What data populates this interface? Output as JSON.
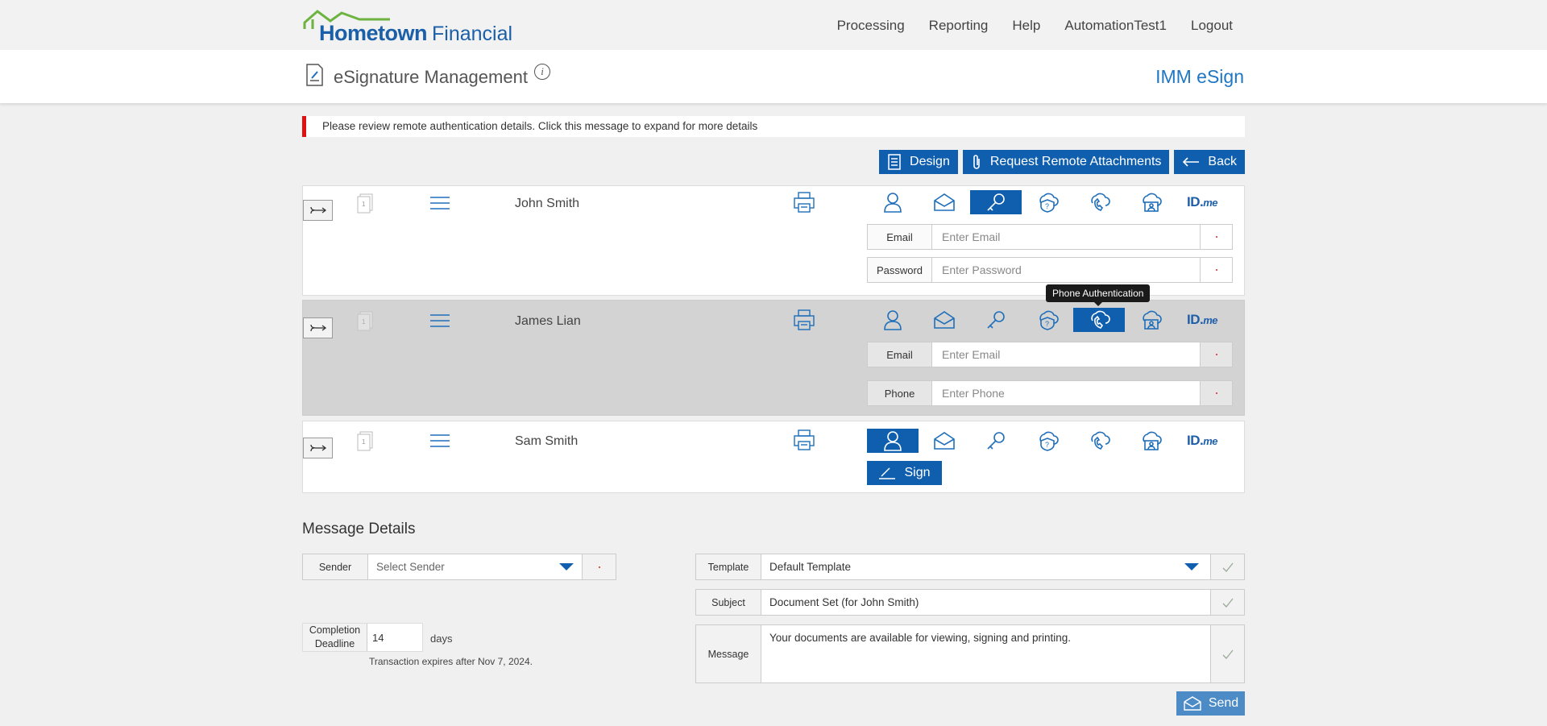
{
  "brand": {
    "name_bold": "Hometown",
    "name_light": "Financial"
  },
  "topnav": [
    "Processing",
    "Reporting",
    "Help",
    "AutomationTest1",
    "Logout"
  ],
  "subheader": {
    "title": "eSignature Management",
    "info_icon": "i",
    "right_title": "IMM eSign"
  },
  "alert": {
    "text": "Please review remote authentication details. Click this message to expand for more details",
    "color": "#e01010"
  },
  "actions": {
    "design": "Design",
    "attachments": "Request Remote Attachments",
    "back": "Back"
  },
  "signers": [
    {
      "name": "John Smith",
      "selected_auth": "key-icon",
      "page_badge": "1",
      "fields": [
        {
          "label": "Email",
          "placeholder": "Enter Email"
        },
        {
          "label": "Password",
          "placeholder": "Enter Password"
        }
      ]
    },
    {
      "name": "James Lian",
      "selected_auth": "phone-icon",
      "page_badge": "1",
      "tooltip": "Phone Authentication",
      "fields": [
        {
          "label": "Email",
          "placeholder": "Enter Email"
        },
        {
          "label": "Phone",
          "placeholder": "Enter Phone"
        }
      ]
    },
    {
      "name": "Sam Smith",
      "selected_auth": "person-icon",
      "page_badge": "1",
      "sign_label": "Sign"
    }
  ],
  "auth_methods": [
    "person-icon",
    "email-icon",
    "key-icon",
    "question-shield-icon",
    "phone-icon",
    "id-card-icon",
    "idme-logo"
  ],
  "idme": {
    "id": "ID.",
    "me": "me"
  },
  "message": {
    "title": "Message Details",
    "sender_label": "Sender",
    "sender_placeholder": "Select Sender",
    "deadline_label_1": "Completion",
    "deadline_label_2": "Deadline",
    "deadline_value": "14",
    "days_label": "days",
    "expires_text": "Transaction expires after Nov 7, 2024.",
    "template_label": "Template",
    "template_value": "Default Template",
    "subject_label": "Subject",
    "subject_value": "Document Set (for John Smith)",
    "message_label": "Message",
    "message_value": "Your documents are available for viewing, signing and printing.",
    "send_label": "Send"
  },
  "colors": {
    "primary": "#0f5fae",
    "accent_blue": "#1f77c4",
    "required_red": "#e02020"
  }
}
